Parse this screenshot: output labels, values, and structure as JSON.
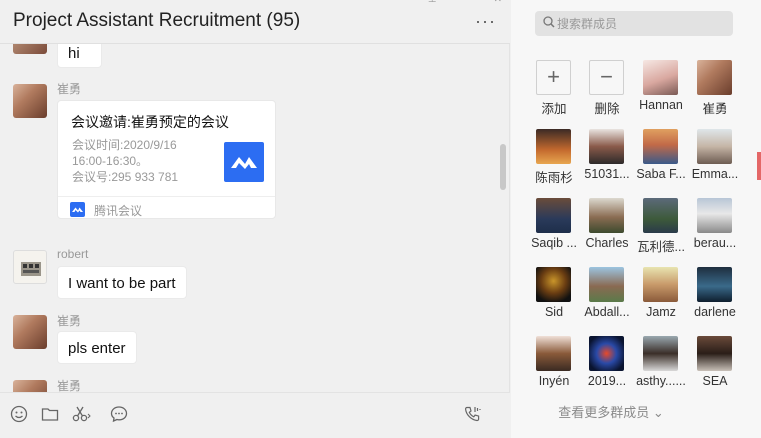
{
  "chat": {
    "title": "Project Assistant Recruitment (95)",
    "more_icon": "···",
    "messages": {
      "m0_text": "hi",
      "m1_sender": "崔勇",
      "m2_sender": "robert",
      "m2_text": "I want to be part",
      "m3_sender": "崔勇",
      "m3_text": "pls enter",
      "m4_sender": "崔勇"
    },
    "card": {
      "title": "会议邀请:崔勇预定的会议",
      "time_label": "会议时间:2020/9/16",
      "time_range": "16:00-16:30。",
      "meeting_id": "会议号:295 933 781",
      "app_name": "腾讯会议"
    }
  },
  "toolbar": {
    "icons": [
      "emoji-icon",
      "folder-icon",
      "scissors-icon",
      "chat-bubble-icon",
      "voice-call-icon"
    ]
  },
  "members_panel": {
    "search_placeholder": "搜索群成员",
    "add_label": "添加",
    "remove_label": "删除",
    "members": [
      "Hannan",
      "崔勇",
      "陈雨杉",
      "51031...",
      "Saba F...",
      "Emma...",
      "Saqib ...",
      "Charles",
      "瓦利德...",
      "berau...",
      "Sid",
      "Abdall...",
      "Jamz",
      "darlene",
      "Inyén",
      "2019...",
      "asthy......",
      "SEA"
    ],
    "view_more": "查看更多群成员 ⌄"
  },
  "colors": {
    "accent": "#2c6df2",
    "background": "#f0f0f0",
    "panel": "#f7f7f7"
  }
}
